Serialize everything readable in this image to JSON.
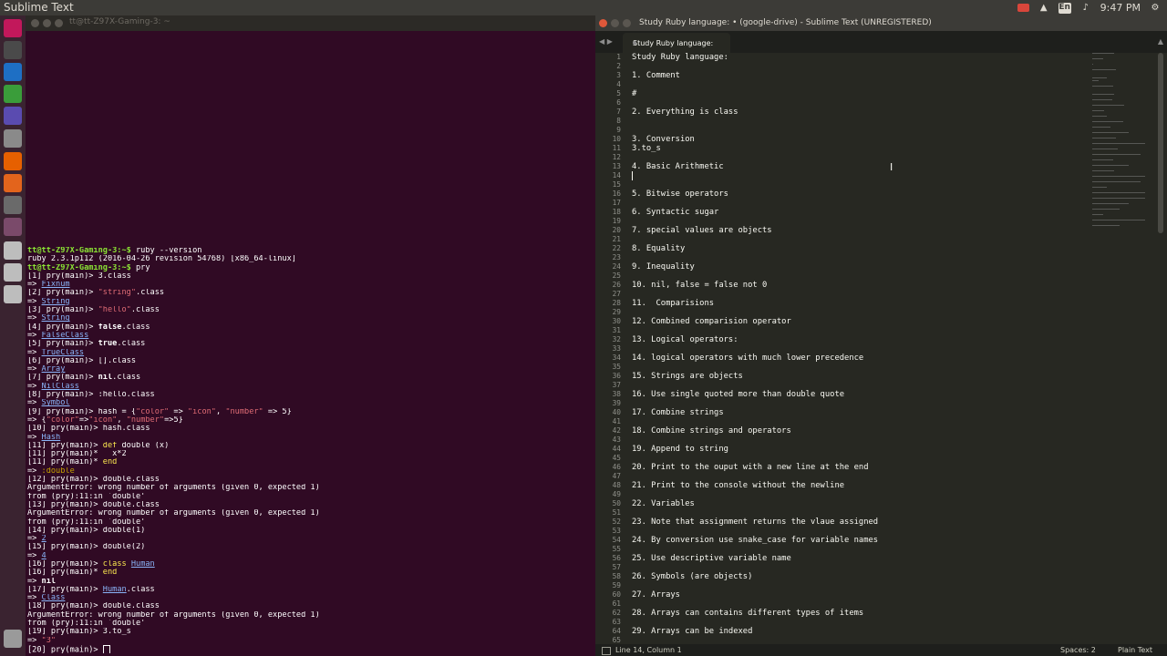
{
  "topbar": {
    "title": "Sublime Text",
    "kb_label": "En",
    "clock": "9:47 PM"
  },
  "launcher": {
    "items": [
      {
        "icon": "ubuntu-dash-icon",
        "color": "#c2185b"
      },
      {
        "icon": "terminal-icon",
        "color": "#4a4a4a"
      },
      {
        "icon": "vscode-icon",
        "color": "#1e6fc4"
      },
      {
        "icon": "chrome-icon",
        "color": "#3a9d3a"
      },
      {
        "icon": "visual-studio-icon",
        "color": "#5a4bb0"
      },
      {
        "icon": "file-manager-icon",
        "color": "#8a8a8a"
      },
      {
        "icon": "firefox-icon",
        "color": "#e66000"
      },
      {
        "icon": "intellij-icon",
        "color": "#e3641c"
      },
      {
        "icon": "sublime-text-icon",
        "color": "#6a6a6a"
      },
      {
        "icon": "workspace-icon",
        "color": "#7a4a6a"
      },
      {
        "icon": "drive-icon",
        "color": "#bdbdbd"
      },
      {
        "icon": "drive-icon",
        "color": "#bdbdbd"
      },
      {
        "icon": "drive-icon",
        "color": "#bdbdbd"
      },
      {
        "icon": "trash-icon",
        "color": "#9a9a9a"
      }
    ]
  },
  "terminal": {
    "title": "tt@tt-Z97X-Gaming-3: ~",
    "lines": [
      [
        {
          "t": "tt@tt-Z97X-Gaming-3:~$",
          "c": "g"
        },
        {
          "t": " ruby --version"
        }
      ],
      [
        {
          "t": "ruby 2.3.1p112 (2016-04-26 revision 54768) [x86_64-linux]"
        }
      ],
      [
        {
          "t": "tt@tt-Z97X-Gaming-3:~$",
          "c": "g"
        },
        {
          "t": " pry"
        }
      ],
      [
        {
          "t": "[1] pry(main)> 3.class"
        }
      ],
      [
        {
          "t": "=> "
        },
        {
          "t": "Fixnum",
          "c": "u"
        }
      ],
      [
        {
          "t": "[2] pry(main)> "
        },
        {
          "t": "\"string\"",
          "c": "s"
        },
        {
          "t": ".class"
        }
      ],
      [
        {
          "t": "=> "
        },
        {
          "t": "String",
          "c": "u"
        }
      ],
      [
        {
          "t": "[3] pry(main)> "
        },
        {
          "t": "\"hello\"",
          "c": "s"
        },
        {
          "t": ".class"
        }
      ],
      [
        {
          "t": "=> "
        },
        {
          "t": "String",
          "c": "u"
        }
      ],
      [
        {
          "t": "[4] pry(main)> "
        },
        {
          "t": "false",
          "c": "b"
        },
        {
          "t": ".class"
        }
      ],
      [
        {
          "t": "=> "
        },
        {
          "t": "FalseClass",
          "c": "u"
        }
      ],
      [
        {
          "t": "[5] pry(main)> "
        },
        {
          "t": "true",
          "c": "b"
        },
        {
          "t": ".class"
        }
      ],
      [
        {
          "t": "=> "
        },
        {
          "t": "TrueClass",
          "c": "u"
        }
      ],
      [
        {
          "t": "[6] pry(main)> [].class"
        }
      ],
      [
        {
          "t": "=> "
        },
        {
          "t": "Array",
          "c": "u"
        }
      ],
      [
        {
          "t": "[7] pry(main)> "
        },
        {
          "t": "nil",
          "c": "b"
        },
        {
          "t": ".class"
        }
      ],
      [
        {
          "t": "=> "
        },
        {
          "t": "NilClass",
          "c": "u"
        }
      ],
      [
        {
          "t": "[8] pry(main)> :hello.class"
        }
      ],
      [
        {
          "t": "=> "
        },
        {
          "t": "Symbol",
          "c": "u"
        }
      ],
      [
        {
          "t": "[9] pry(main)> hash = {"
        },
        {
          "t": "\"color\"",
          "c": "s"
        },
        {
          "t": " => "
        },
        {
          "t": "\"icon\"",
          "c": "s"
        },
        {
          "t": ", "
        },
        {
          "t": "\"number\"",
          "c": "s"
        },
        {
          "t": " => 5}"
        }
      ],
      [
        {
          "t": "=> {"
        },
        {
          "t": "\"color\"",
          "c": "s"
        },
        {
          "t": "=>"
        },
        {
          "t": "\"icon\"",
          "c": "s"
        },
        {
          "t": ", "
        },
        {
          "t": "\"number\"",
          "c": "s"
        },
        {
          "t": "=>5}"
        }
      ],
      [
        {
          "t": "[10] pry(main)> hash.class"
        }
      ],
      [
        {
          "t": "=> "
        },
        {
          "t": "Hash",
          "c": "u"
        }
      ],
      [
        {
          "t": "[11] pry(main)> "
        },
        {
          "t": "def",
          "c": "k"
        },
        {
          "t": " double (x)"
        }
      ],
      [
        {
          "t": "[11] pry(main)*   x*2"
        }
      ],
      [
        {
          "t": "[11] pry(main)* "
        },
        {
          "t": "end",
          "c": "k"
        }
      ],
      [
        {
          "t": "=> "
        },
        {
          "t": ":double",
          "c": "y"
        }
      ],
      [
        {
          "t": "[12] pry(main)> double.class"
        }
      ],
      [
        {
          "t": "ArgumentError: wrong number of arguments (given 0, expected 1)"
        }
      ],
      [
        {
          "t": "from (pry):11:in `double'"
        }
      ],
      [
        {
          "t": "[13] pry(main)> double.class"
        }
      ],
      [
        {
          "t": "ArgumentError: wrong number of arguments (given 0, expected 1)"
        }
      ],
      [
        {
          "t": "from (pry):11:in `double'"
        }
      ],
      [
        {
          "t": "[14] pry(main)> double(1)"
        }
      ],
      [
        {
          "t": "=> "
        },
        {
          "t": "2",
          "c": "u"
        }
      ],
      [
        {
          "t": "[15] pry(main)> double(2)"
        }
      ],
      [
        {
          "t": "=> "
        },
        {
          "t": "4",
          "c": "u"
        }
      ],
      [
        {
          "t": "[16] pry(main)> "
        },
        {
          "t": "class",
          "c": "k"
        },
        {
          "t": " "
        },
        {
          "t": "Human",
          "c": "u"
        }
      ],
      [
        {
          "t": "[16] pry(main)* "
        },
        {
          "t": "end",
          "c": "k"
        }
      ],
      [
        {
          "t": "=> "
        },
        {
          "t": "nil",
          "c": "b"
        }
      ],
      [
        {
          "t": "[17] pry(main)> "
        },
        {
          "t": "Human",
          "c": "u"
        },
        {
          "t": ".class"
        }
      ],
      [
        {
          "t": "=> "
        },
        {
          "t": "Class",
          "c": "u"
        }
      ],
      [
        {
          "t": "[18] pry(main)> double.class"
        }
      ],
      [
        {
          "t": "ArgumentError: wrong number of arguments (given 0, expected 1)"
        }
      ],
      [
        {
          "t": "from (pry):11:in `double'"
        }
      ],
      [
        {
          "t": "[19] pry(main)> 3.to_s"
        }
      ],
      [
        {
          "t": "=> "
        },
        {
          "t": "\"3\"",
          "c": "s"
        }
      ],
      [
        {
          "t": "[20] pry(main)> "
        },
        {
          "t": "",
          "c": "cursor"
        }
      ]
    ]
  },
  "sublime": {
    "title": "Study Ruby language: • (google-drive) - Sublime Text (UNREGISTERED)",
    "tab_label": "Study Ruby language:",
    "line_numbers": [
      "1",
      "2",
      "3",
      "4",
      "5",
      "6",
      "7",
      "8",
      "9",
      "10",
      "11",
      "12",
      "13",
      "14",
      "15",
      "16",
      "17",
      "18",
      "19",
      "20",
      "21",
      "22",
      "23",
      "24",
      "25",
      "26",
      "27",
      "28",
      "29",
      "30",
      "31",
      "32",
      "33",
      "34",
      "35",
      "36",
      "37",
      "38",
      "39",
      "40",
      "41",
      "42",
      "43",
      "44",
      "45",
      "46",
      "47",
      "48",
      "49",
      "50",
      "51",
      "52",
      "53",
      "54",
      "55",
      "56",
      "57",
      "58",
      "59",
      "60",
      "61",
      "62",
      "63",
      "64",
      "65"
    ],
    "code_lines": [
      "Study Ruby language:",
      "",
      "1. Comment",
      "",
      "#",
      "",
      "2. Everything is class",
      "",
      "",
      "3. Conversion",
      "3.to_s",
      "",
      "4. Basic Arithmetic",
      "",
      "",
      "5. Bitwise operators",
      "",
      "6. Syntactic sugar",
      "",
      "7. special values are objects",
      "",
      "8. Equality",
      "",
      "9. Inequality",
      "",
      "10. nil, false = false not 0",
      "",
      "11.  Comparisions",
      "",
      "12. Combined comparision operator",
      "",
      "13. Logical operators:",
      "",
      "14. logical operators with much lower precedence",
      "",
      "15. Strings are objects",
      "",
      "16. Use single quoted more than double quote",
      "",
      "17. Combine strings",
      "",
      "18. Combine strings and operators",
      "",
      "19. Append to string",
      "",
      "20. Print to the ouput with a new line at the end",
      "",
      "21. Print to the console without the newline",
      "",
      "22. Variables",
      "",
      "23. Note that assignment returns the vlaue assigned",
      "",
      "24. By conversion use snake_case for variable names",
      "",
      "25. Use descriptive variable name",
      "",
      "26. Symbols (are objects)",
      "",
      "27. Arrays",
      "",
      "28. Arrays can contains different types of items",
      "",
      "29. Arrays can be indexed",
      ""
    ],
    "caret_line": 14,
    "minimap_lines": 64,
    "status": {
      "position": "Line 14, Column 1",
      "spaces": "Spaces: 2",
      "syntax": "Plain Text"
    }
  },
  "colors": {
    "terminal_bg": "#300a24",
    "editor_bg": "#272822",
    "prompt_green": "#8ae234"
  }
}
